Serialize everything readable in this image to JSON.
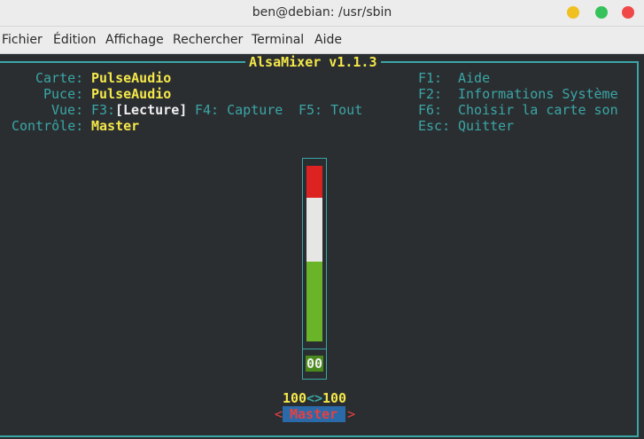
{
  "window": {
    "title": "ben@debian: /usr/sbin",
    "buttons": {
      "minimize_color": "#f0c020",
      "maximize_color": "#36c25a",
      "close_color": "#f04848"
    }
  },
  "menubar": {
    "items": [
      "Fichier",
      "Édition",
      "Affichage",
      "Rechercher",
      "Terminal",
      "Aide"
    ]
  },
  "alsamixer": {
    "title": "AlsaMixer v1.1.3",
    "card_label": "Carte:",
    "card_value": "PulseAudio",
    "chip_label": "Puce:",
    "chip_value": "PulseAudio",
    "view_label": "Vue:",
    "view_f3_key": "F3:",
    "view_f3_value": "[Lecture]",
    "view_f4": "F4: Capture",
    "view_f5": "F5: Tout",
    "control_label": "Contrôle:",
    "control_value": "Master",
    "help": [
      {
        "key": "F1:",
        "label": "Aide"
      },
      {
        "key": "F2:",
        "label": "Informations Système"
      },
      {
        "key": "F6:",
        "label": "Choisir la carte son"
      },
      {
        "key": "Esc:",
        "label": "Quitter"
      }
    ],
    "channel": {
      "volume_fraction": 1.0,
      "mute_indicator": "00",
      "volume_left": "100",
      "volume_sep": "<>",
      "volume_right": "100",
      "name": "Master",
      "arrow_left": "<",
      "arrow_right": ">"
    },
    "colors": {
      "accent": "#3aa6a6",
      "highlight": "#f4e84a",
      "meter_high": "#dd2222",
      "meter_mid": "#e6e6e4",
      "meter_low": "#6ab42a",
      "selected_bg": "#2a6aa8",
      "selected_fg": "#e84040"
    }
  }
}
